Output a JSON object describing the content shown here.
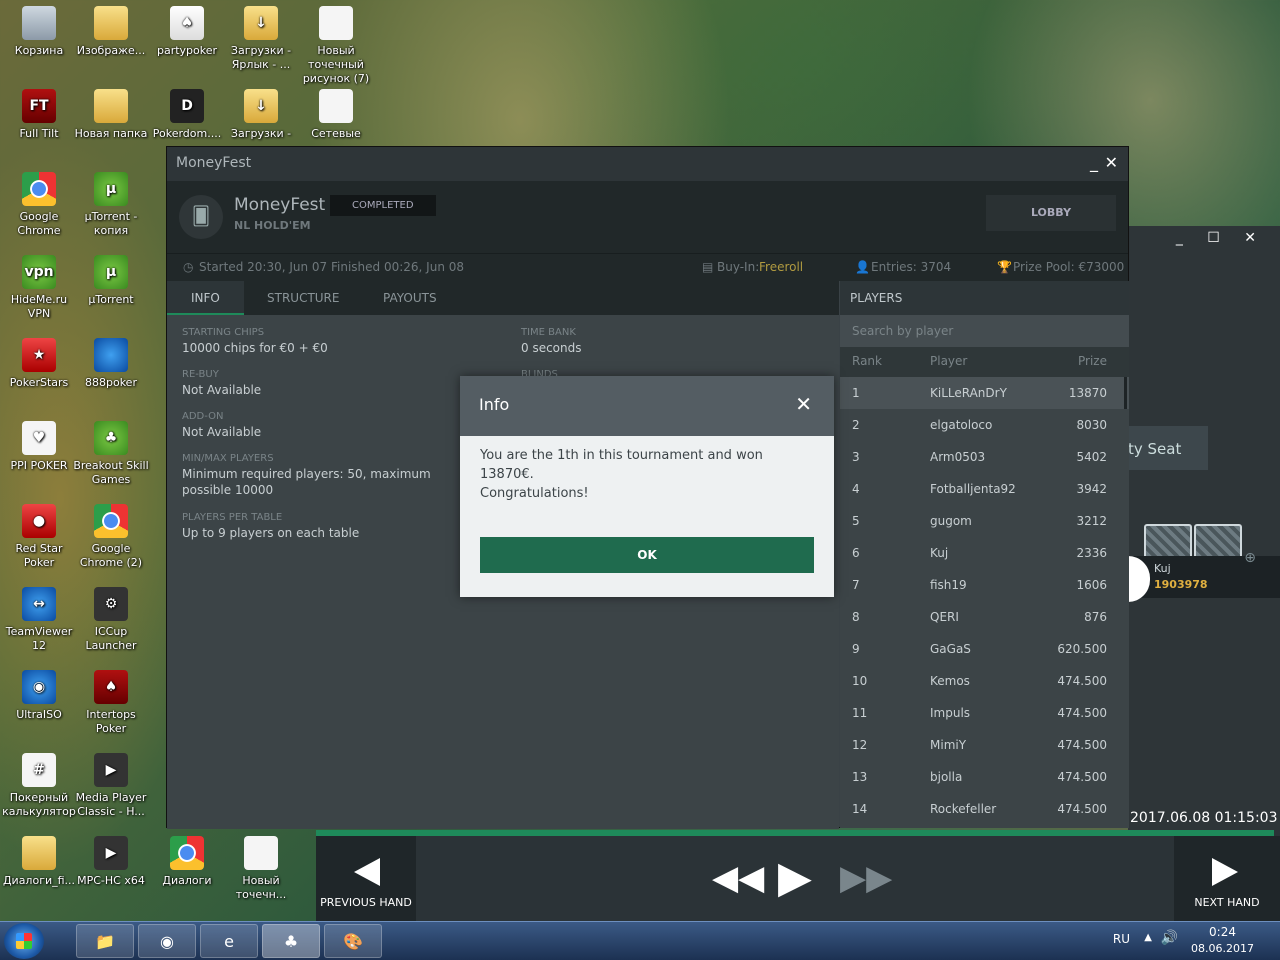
{
  "desktop": {
    "icons": [
      {
        "label": "Корзина"
      },
      {
        "label": "Изображе..."
      },
      {
        "label": "partypoker"
      },
      {
        "label": "Загрузки - Ярлык - ..."
      },
      {
        "label": "Новый точечный рисунок (7)"
      },
      {
        "label": "Full Tilt"
      },
      {
        "label": "Новая папка"
      },
      {
        "label": "Pokerdom...."
      },
      {
        "label": "Загрузки -"
      },
      {
        "label": "Сетевые"
      },
      {
        "label": "Google Chrome"
      },
      {
        "label": "µTorrent - копия"
      },
      {
        "label": "HideMe.ru VPN"
      },
      {
        "label": "µTorrent"
      },
      {
        "label": "PokerStars"
      },
      {
        "label": "888poker"
      },
      {
        "label": "PPI POKER"
      },
      {
        "label": "Breakout Skill Games"
      },
      {
        "label": "Red Star Poker"
      },
      {
        "label": "Google Chrome (2)"
      },
      {
        "label": "TeamViewer 12"
      },
      {
        "label": "ICCup Launcher"
      },
      {
        "label": "UltraISO"
      },
      {
        "label": "Intertops Poker"
      },
      {
        "label": "Покерный калькулятор"
      },
      {
        "label": "Media Player Classic - H..."
      },
      {
        "label": "Диалоги_fi..."
      },
      {
        "label": "MPC-HC x64"
      },
      {
        "label": "Диалоги"
      },
      {
        "label": "Новый точечн..."
      }
    ]
  },
  "bg_window": {
    "empty_seat": "ty Seat",
    "player_name": "Kuj",
    "player_chips": "1903978",
    "timestamp": "2017.06.08 01:15:03"
  },
  "replay": {
    "prev_label": "PREVIOUS HAND",
    "next_label": "NEXT HAND"
  },
  "window": {
    "title": "MoneyFest",
    "minimize": "_",
    "close": "✕",
    "tournament_name": "MoneyFest",
    "game_type": "NL HOLD'EM",
    "status": "COMPLETED",
    "lobby_label": "LOBBY",
    "started": "Started 20:30, Jun 07",
    "finished": "Finished 00:26, Jun 08",
    "buyin_label": "Buy-In:",
    "buyin_value": "Freeroll",
    "entries": "Entries: 3704",
    "prize_pool": "Prize Pool: €73000"
  },
  "tabs": [
    {
      "label": "INFO"
    },
    {
      "label": "STRUCTURE"
    },
    {
      "label": "PAYOUTS"
    }
  ],
  "info": {
    "starting_chips": {
      "label": "STARTING CHIPS",
      "value": "10000 chips for €0 + €0"
    },
    "rebuy": {
      "label": "RE-BUY",
      "value": "Not Available"
    },
    "addon": {
      "label": "ADD-ON",
      "value": "Not Available"
    },
    "minmax": {
      "label": "MIN/MAX PLAYERS",
      "value": "Minimum required players: 50, maximum possible 10000"
    },
    "per_table": {
      "label": "PLAYERS PER TABLE",
      "value": "Up to 9 players on each table"
    },
    "time_bank": {
      "label": "TIME BANK",
      "value": "0 seconds"
    },
    "blinds": {
      "label": "BLINDS"
    }
  },
  "players": {
    "header": "PLAYERS",
    "search_placeholder": "Search by player",
    "col_rank": "Rank",
    "col_player": "Player",
    "col_prize": "Prize",
    "rows": [
      {
        "rank": "1",
        "name": "KiLLeRAnDrY",
        "prize": "13870"
      },
      {
        "rank": "2",
        "name": "elgatoloco",
        "prize": "8030"
      },
      {
        "rank": "3",
        "name": "Arm0503",
        "prize": "5402"
      },
      {
        "rank": "4",
        "name": "Fotballjenta92",
        "prize": "3942"
      },
      {
        "rank": "5",
        "name": "gugom",
        "prize": "3212"
      },
      {
        "rank": "6",
        "name": "Kuj",
        "prize": "2336"
      },
      {
        "rank": "7",
        "name": "fish19",
        "prize": "1606"
      },
      {
        "rank": "8",
        "name": "QERI",
        "prize": "876"
      },
      {
        "rank": "9",
        "name": "GaGaS",
        "prize": "620.500"
      },
      {
        "rank": "10",
        "name": "Kemos",
        "prize": "474.500"
      },
      {
        "rank": "11",
        "name": "Impuls",
        "prize": "474.500"
      },
      {
        "rank": "12",
        "name": "MimiY",
        "prize": "474.500"
      },
      {
        "rank": "13",
        "name": "bjolla",
        "prize": "474.500"
      },
      {
        "rank": "14",
        "name": "Rockefeller",
        "prize": "474.500"
      }
    ]
  },
  "modal": {
    "title": "Info",
    "close": "✕",
    "line1": "You are the 1th in this tournament and won 13870€.",
    "line2": "Congratulations!",
    "ok_label": "OK"
  },
  "taskbar": {
    "lang": "RU",
    "time": "0:24",
    "date": "08.06.2017"
  }
}
